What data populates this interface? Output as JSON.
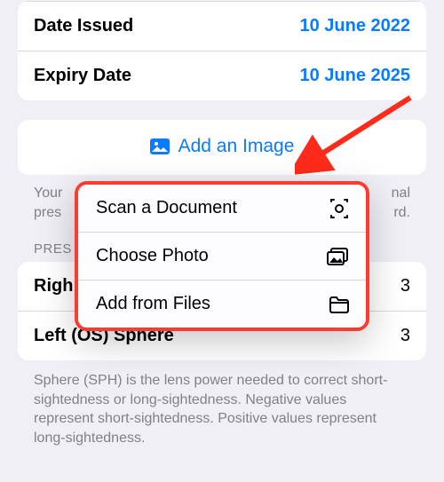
{
  "dates": {
    "issued_label": "Date Issued",
    "issued_value": "10 June 2022",
    "expiry_label": "Expiry Date",
    "expiry_value": "10 June 2025"
  },
  "add_image_label": "Add an Image",
  "hint_line1": "Your",
  "hint_line2": "pres",
  "hint_right1": "nal",
  "hint_right2": "rd.",
  "section_header": "PRES",
  "sphere": {
    "right_label": "Righ",
    "right_value": "3",
    "left_label": "Left (OS) Sphere",
    "left_value": "3"
  },
  "explain": "Sphere (SPH) is the lens power needed to correct short-sightedness or long-sightedness. Negative values represent short-sightedness. Positive values represent long-sightedness.",
  "popover": {
    "scan": "Scan a Document",
    "choose": "Choose Photo",
    "files": "Add from Files"
  }
}
